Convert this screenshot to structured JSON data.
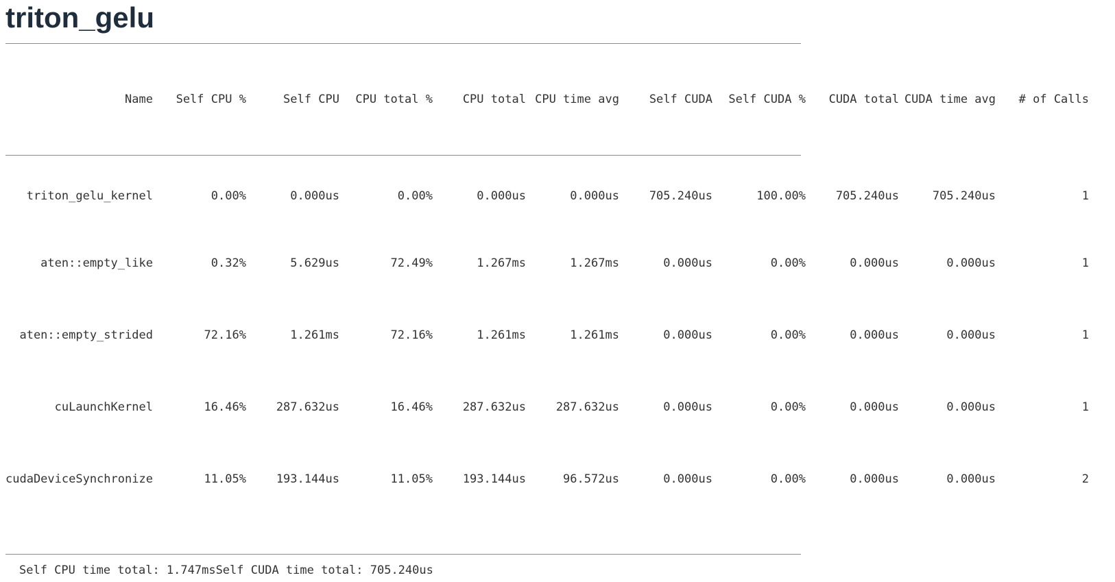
{
  "title": "triton_gelu",
  "table": {
    "columns": [
      "Name",
      "Self CPU %",
      "Self CPU",
      "CPU total %",
      "CPU total",
      "CPU time avg",
      "Self CUDA",
      "Self CUDA %",
      "CUDA total",
      "CUDA time avg",
      "# of Calls"
    ],
    "rows": [
      [
        "triton_gelu_kernel",
        "0.00%",
        "0.000us",
        "0.00%",
        "0.000us",
        "0.000us",
        "705.240us",
        "100.00%",
        "705.240us",
        "705.240us",
        "1"
      ],
      [
        "aten::empty_like",
        "0.32%",
        "5.629us",
        "72.49%",
        "1.267ms",
        "1.267ms",
        "0.000us",
        "0.00%",
        "0.000us",
        "0.000us",
        "1"
      ],
      [
        "aten::empty_strided",
        "72.16%",
        "1.261ms",
        "72.16%",
        "1.261ms",
        "1.261ms",
        "0.000us",
        "0.00%",
        "0.000us",
        "0.000us",
        "1"
      ],
      [
        "cuLaunchKernel",
        "16.46%",
        "287.632us",
        "16.46%",
        "287.632us",
        "287.632us",
        "0.000us",
        "0.00%",
        "0.000us",
        "0.000us",
        "1"
      ],
      [
        "cudaDeviceSynchronize",
        "11.05%",
        "193.144us",
        "11.05%",
        "193.144us",
        "96.572us",
        "0.000us",
        "0.00%",
        "0.000us",
        "0.000us",
        "2"
      ]
    ]
  },
  "footer": {
    "summary": "Self CPU time total: 1.747msSelf CUDA time total: 705.240us"
  }
}
